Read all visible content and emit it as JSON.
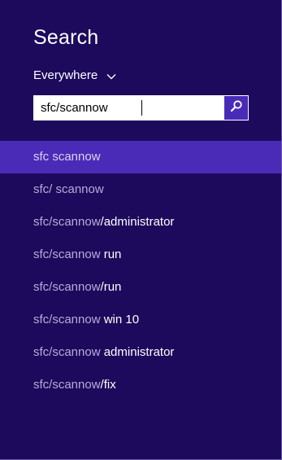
{
  "title": "Search",
  "scope": {
    "label": "Everywhere",
    "icon": "chevron-down-icon"
  },
  "search": {
    "value": "sfc/scannow",
    "button_icon": "search-icon"
  },
  "suggestions": [
    {
      "match": "sfc scannow",
      "rest": "",
      "selected": true
    },
    {
      "match": "sfc/ scannow",
      "rest": "",
      "selected": false
    },
    {
      "match": "sfc/scannow",
      "rest": "/administrator",
      "selected": false
    },
    {
      "match": "sfc/scannow",
      "rest": " run",
      "selected": false
    },
    {
      "match": "sfc/scannow",
      "rest": "/run",
      "selected": false
    },
    {
      "match": "sfc/scannow",
      "rest": " win 10",
      "selected": false
    },
    {
      "match": "sfc/scannow",
      "rest": " administrator",
      "selected": false
    },
    {
      "match": "sfc/scannow",
      "rest": "/fix",
      "selected": false
    }
  ],
  "colors": {
    "background": "#1d0a5c",
    "accent": "#4a2bb8",
    "suggestion_match": "#b5addb",
    "suggestion_rest": "#ffffff"
  }
}
